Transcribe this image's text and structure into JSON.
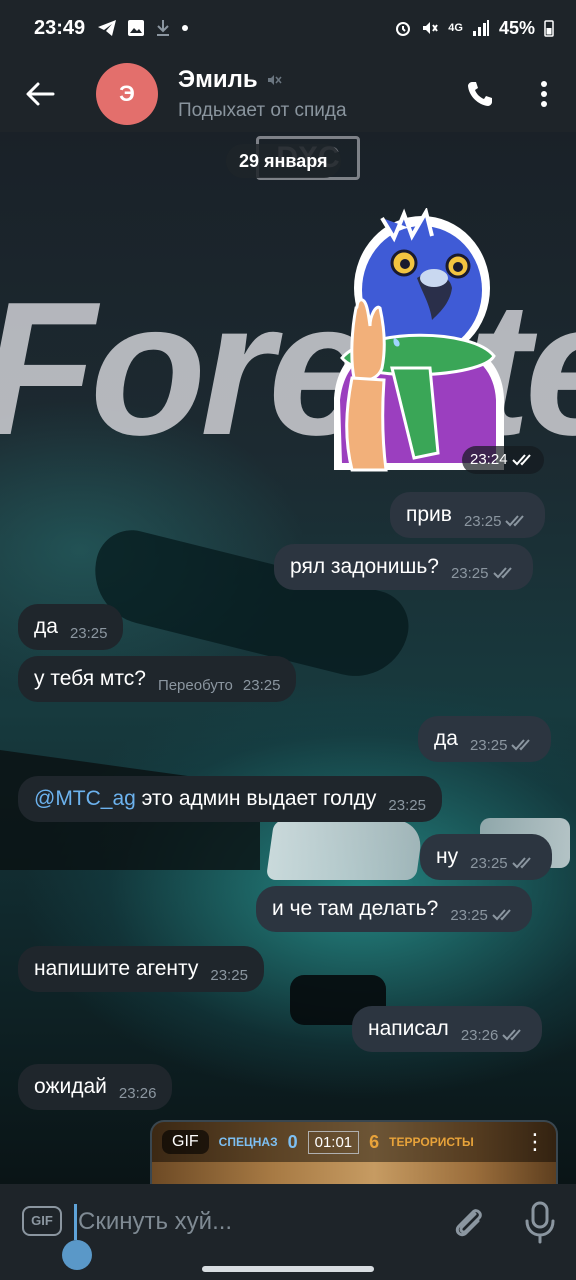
{
  "status_bar": {
    "time": "23:49",
    "battery": "45%",
    "network": "4G"
  },
  "header": {
    "avatar_letter": "Э",
    "avatar_color": "#e36f6c",
    "name": "Эмиль",
    "status": "Подыхает от спида"
  },
  "wallpaper": {
    "badge": "DXC",
    "word": "Forester"
  },
  "date_chip": "29 января",
  "sticker": {
    "time": "23:24"
  },
  "messages": [
    {
      "text": "прив",
      "time": "23:25",
      "direction": "out"
    },
    {
      "text": "рял задонишь?",
      "time": "23:25",
      "direction": "out"
    },
    {
      "text": "да",
      "time": "23:25",
      "direction": "in"
    },
    {
      "text": "у тебя мтс?",
      "time": "23:25",
      "edited": "Переобуто",
      "direction": "in"
    },
    {
      "text": "да",
      "time": "23:25",
      "direction": "out"
    },
    {
      "mention": "@MTC_ag",
      "text": " это админ выдает голду",
      "time": "23:25",
      "direction": "in"
    },
    {
      "text": "ну",
      "time": "23:25",
      "direction": "out"
    },
    {
      "text": "и че там делать?",
      "time": "23:25",
      "direction": "out"
    },
    {
      "text": "напишите агенту",
      "time": "23:25",
      "direction": "in"
    },
    {
      "text": "написал",
      "time": "23:26",
      "direction": "out"
    },
    {
      "text": "ожидай",
      "time": "23:26",
      "direction": "in"
    }
  ],
  "gif_message": {
    "badge": "GIF",
    "team_left": "СПЕЦНАЗ",
    "score_left": "0",
    "clock": "01:01",
    "score_right": "6",
    "team_right": "ТЕРРОРИСТЫ"
  },
  "input": {
    "gif_label": "GIF",
    "placeholder": "Скинуть хуй..."
  },
  "colors": {
    "accent": "#6cb2ee",
    "bubble_out": "#2c3540",
    "bubble_in": "#1f262c"
  }
}
